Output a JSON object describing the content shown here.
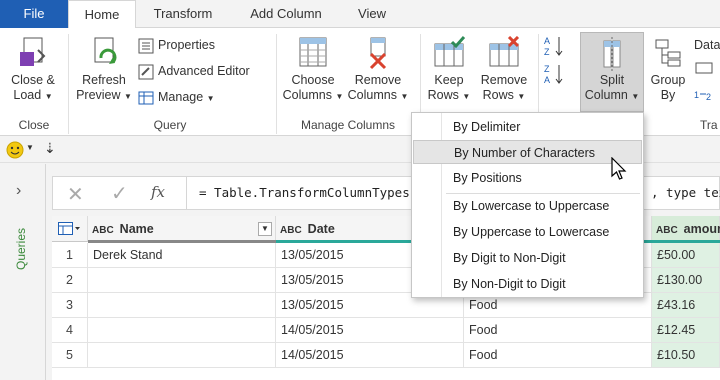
{
  "tabs": [
    {
      "label": "File"
    },
    {
      "label": "Home"
    },
    {
      "label": "Transform"
    },
    {
      "label": "Add Column"
    },
    {
      "label": "View"
    }
  ],
  "ribbon": {
    "close_load": {
      "line1": "Close &",
      "line2": "Load"
    },
    "refresh_preview": {
      "line1": "Refresh",
      "line2": "Preview"
    },
    "properties": "Properties",
    "advanced_editor": "Advanced Editor",
    "manage": "Manage",
    "choose_columns": {
      "line1": "Choose",
      "line2": "Columns"
    },
    "remove_columns": {
      "line1": "Remove",
      "line2": "Columns"
    },
    "keep_rows": {
      "line1": "Keep",
      "line2": "Rows"
    },
    "remove_rows": {
      "line1": "Remove",
      "line2": "Rows"
    },
    "split_column": {
      "line1": "Split",
      "line2": "Column"
    },
    "group_by": {
      "line1": "Group",
      "line2": "By"
    },
    "data_partial": "Data",
    "groups": {
      "close": "Close",
      "query": "Query",
      "manage_columns": "Manage Columns",
      "transform_partial": "Tra"
    }
  },
  "queries_label": "Queries",
  "formula_bar": {
    "fx": "fx",
    "formula_text": "= Table.TransformColumnTypes",
    "formula_tail": ", type text"
  },
  "split_menu": {
    "items": [
      "By Delimiter",
      "By Number of Characters",
      "By Positions",
      "By Lowercase to Uppercase",
      "By Uppercase to Lowercase",
      "By Digit to Non-Digit",
      "By Non-Digit to Digit"
    ],
    "highlighted_index": 1
  },
  "grid": {
    "abc_label": "ABC",
    "columns": [
      "Name",
      "Date",
      "",
      "amoun"
    ],
    "rows": [
      {
        "n": "1",
        "name": "Derek Stand",
        "date": "13/05/2015",
        "cat": "",
        "amount": "£50.00"
      },
      {
        "n": "2",
        "name": "",
        "date": "13/05/2015",
        "cat": "",
        "amount": "£130.00"
      },
      {
        "n": "3",
        "name": "",
        "date": "13/05/2015",
        "cat": "Food",
        "amount": "£43.16"
      },
      {
        "n": "4",
        "name": "",
        "date": "14/05/2015",
        "cat": "Food",
        "amount": "£12.45"
      },
      {
        "n": "5",
        "name": "",
        "date": "14/05/2015",
        "cat": "Food",
        "amount": "£10.50"
      }
    ]
  },
  "colors": {
    "file_tab": "#1f5fb4",
    "teal_bar": "#2aa89a",
    "amount_col": "#dff1e3",
    "queries_text": "#3c8a3c"
  }
}
